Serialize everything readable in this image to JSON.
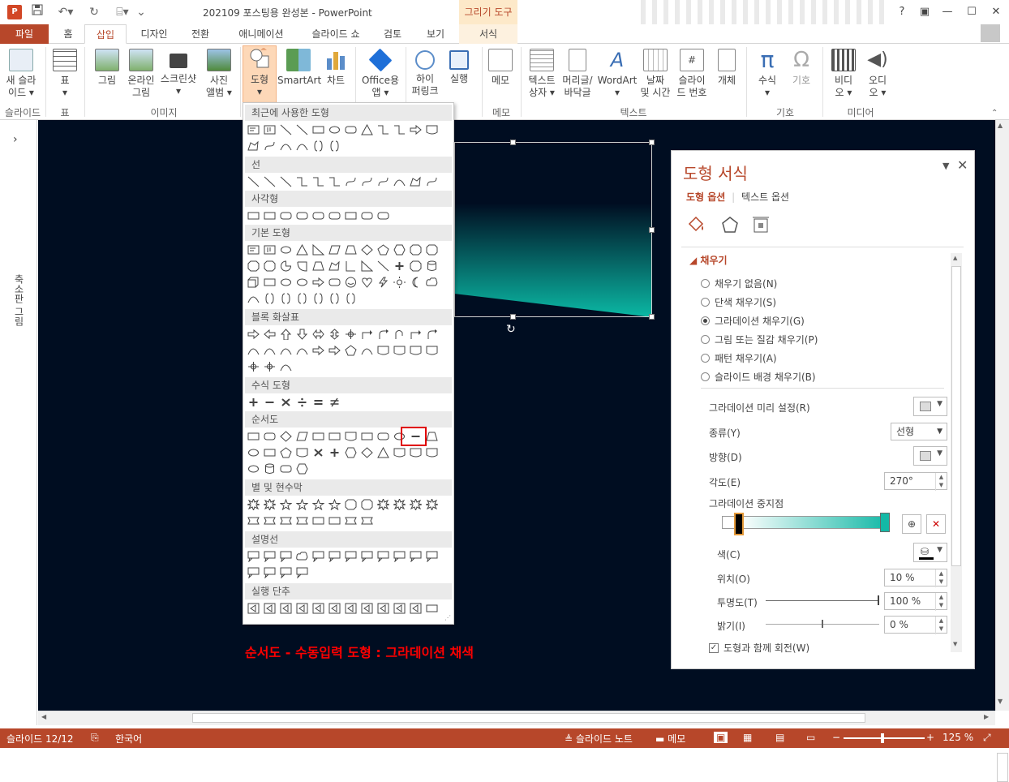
{
  "app": {
    "icon_letter": "P",
    "doc_title": "202109 포스팅용 완성본 - PowerPoint",
    "contextual_group": "그리기 도구"
  },
  "window": {
    "help": "?"
  },
  "tabs": [
    {
      "label": "파일"
    },
    {
      "label": "홈"
    },
    {
      "label": "삽입"
    },
    {
      "label": "디자인"
    },
    {
      "label": "전환"
    },
    {
      "label": "애니메이션"
    },
    {
      "label": "슬라이드 쇼"
    },
    {
      "label": "검토"
    },
    {
      "label": "보기"
    },
    {
      "label": "서식"
    }
  ],
  "ribbon": {
    "buttons": [
      {
        "l1": "새 슬라",
        "l2": "이드 ▾"
      },
      {
        "l1": "표",
        "l2": "▾"
      },
      {
        "l1": "그림",
        "l2": ""
      },
      {
        "l1": "온라인",
        "l2": "그림"
      },
      {
        "l1": "스크린샷",
        "l2": "▾"
      },
      {
        "l1": "사진",
        "l2": "앨범 ▾"
      },
      {
        "l1": "도형",
        "l2": "▾"
      },
      {
        "l1": "SmartArt",
        "l2": ""
      },
      {
        "l1": "차트",
        "l2": ""
      },
      {
        "l1": "Office용",
        "l2": "앱 ▾"
      },
      {
        "l1": "하이",
        "l2": "퍼링크"
      },
      {
        "l1": "실행",
        "l2": ""
      },
      {
        "l1": "메모",
        "l2": ""
      },
      {
        "l1": "텍스트",
        "l2": "상자 ▾"
      },
      {
        "l1": "머리글/",
        "l2": "바닥글"
      },
      {
        "l1": "WordArt",
        "l2": "▾"
      },
      {
        "l1": "날짜",
        "l2": "및 시간"
      },
      {
        "l1": "슬라이",
        "l2": "드 번호"
      },
      {
        "l1": "개체",
        "l2": ""
      },
      {
        "l1": "수식",
        "l2": "▾"
      },
      {
        "l1": "기호",
        "l2": ""
      },
      {
        "l1": "비디",
        "l2": "오 ▾"
      },
      {
        "l1": "오디",
        "l2": "오 ▾"
      }
    ],
    "groups": [
      "슬라이드",
      "표",
      "이미지",
      "메모",
      "텍스트",
      "기호",
      "미디어"
    ]
  },
  "left_nav": {
    "label": "축소판 그림",
    "arrow": "›"
  },
  "shapes_menu": {
    "categories": [
      "최근에 사용한 도형",
      "선",
      "사각형",
      "기본 도형",
      "블록 화살표",
      "수식 도형",
      "순서도",
      "별 및 현수막",
      "설명선",
      "실행 단추"
    ]
  },
  "caption": "순서도 - 수동입력 도형 : 그라데이션 채색",
  "format_pane": {
    "title": "도형 서식",
    "tab_shape": "도형 옵션",
    "tab_text": "텍스트 옵션",
    "section": "채우기",
    "fill_options": [
      {
        "label": "채우기 없음(N)",
        "selected": false
      },
      {
        "label": "단색 채우기(S)",
        "selected": false
      },
      {
        "label": "그라데이션 채우기(G)",
        "selected": true
      },
      {
        "label": "그림 또는 질감 채우기(P)",
        "selected": false
      },
      {
        "label": "패턴 채우기(A)",
        "selected": false
      },
      {
        "label": "슬라이드 배경 채우기(B)",
        "selected": false
      }
    ],
    "preset_label": "그라데이션 미리 설정(R)",
    "type_label": "종류(Y)",
    "type_value": "선형",
    "direction_label": "방향(D)",
    "angle_label": "각도(E)",
    "angle_value": "270°",
    "stops_label": "그라데이션 중지점",
    "color_label": "색(C)",
    "position_label": "위치(O)",
    "position_value": "10 %",
    "transparency_label": "투명도(T)",
    "transparency_value": "100 %",
    "brightness_label": "밝기(I)",
    "brightness_value": "0 %",
    "rotate_label": "도형과 함께 회전(W)",
    "rotate_checked": true,
    "gradient_start": "#ffffff",
    "gradient_end": "#14b8a6"
  },
  "status": {
    "slide": "슬라이드 12/12",
    "language": "한국어",
    "notes": "슬라이드 노트",
    "comments": "메모",
    "zoom": "125 %"
  },
  "colors": {
    "accent": "#b7472a",
    "slide_bg": "#000d21",
    "shape_teal": "#0bb8a4"
  }
}
